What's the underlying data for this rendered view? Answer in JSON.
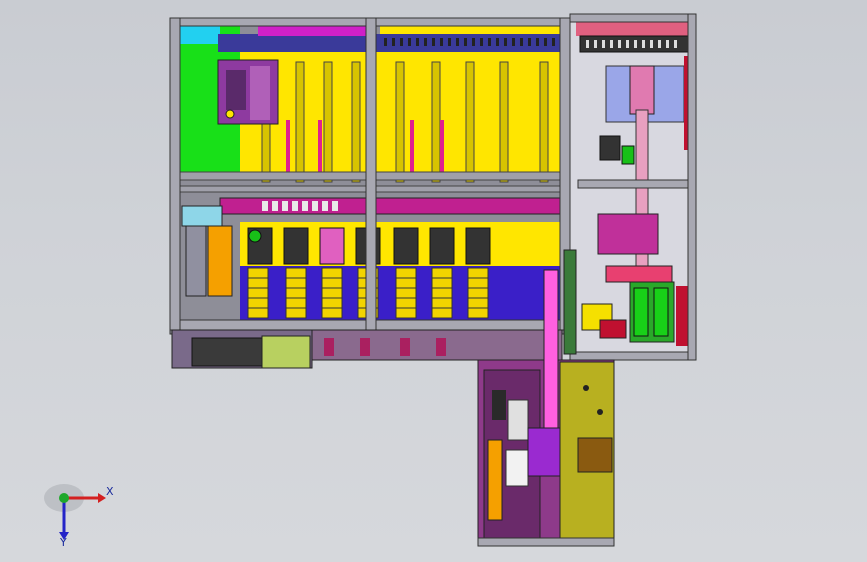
{
  "triad": {
    "x_label": "X",
    "y_label": "Y",
    "x_color": "#d42020",
    "y_color": "#2424c8",
    "z_color": "#1fa82b"
  },
  "colors": {
    "frame": "#8f8f99",
    "green_panel": "#18e018",
    "yellow_panel": "#ffe600",
    "blue_panel": "#3a1fc8",
    "purple_panel": "#8e3aa0",
    "light_blue": "#9aa6e8",
    "olive": "#b8b020",
    "magenta": "#d020c8",
    "orange": "#f5a000"
  }
}
